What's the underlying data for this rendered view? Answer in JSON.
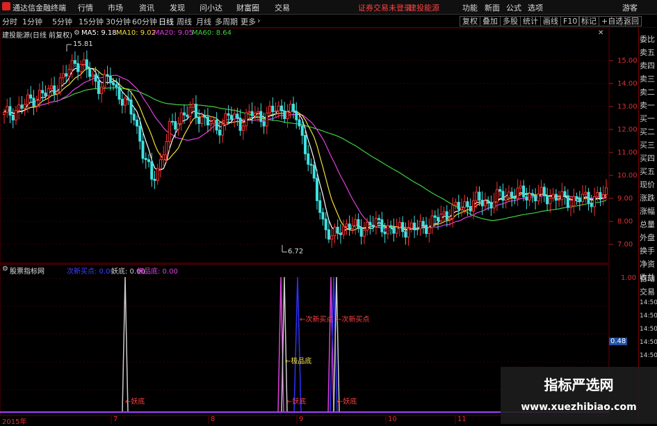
{
  "menubar": {
    "app_title": "通达信金融终端",
    "items": [
      "行情",
      "市场",
      "资讯",
      "发现",
      "问小达",
      "财富圈",
      "交易"
    ],
    "notice": "证券交易未登录",
    "stock": "建投能源",
    "right_items": [
      "功能",
      "新面",
      "公式",
      "选项"
    ],
    "guest": "游客"
  },
  "periodbar": {
    "periods": [
      "分时",
      "1分钟",
      "5分钟",
      "15分钟",
      "30分钟",
      "60分钟",
      "日线",
      "周线",
      "月线",
      "多周期",
      "更多"
    ],
    "selected": "日线",
    "buttons": [
      "复权",
      "叠加",
      "多股",
      "统计",
      "画线",
      "F10",
      "标记",
      "+自选",
      "返回"
    ]
  },
  "main_legend": {
    "title": "建投能源(日线 前复权)",
    "ma5": "MA5: 9.18",
    "ma10": "MA10: 9.02",
    "ma20": "MA20: 9.05",
    "ma60": "MA60: 8.64"
  },
  "price_axis": [
    "15.00",
    "14.00",
    "13.00",
    "12.00",
    "11.00",
    "10.00",
    "9.00",
    "8.00",
    "7.00"
  ],
  "annotations": {
    "high": "15.81",
    "low": "6.72"
  },
  "indicator_legend": {
    "title": "股票指标网",
    "item1": "次新买点: 0.00",
    "item2": "妖底: 0.00",
    "item3": "极品底: 0.00"
  },
  "indicator_axis": [
    "1.00",
    "0.48"
  ],
  "indicator_labels": {
    "yaodi": "妖底",
    "jipindi": "极品底",
    "cixin": "次新买点"
  },
  "time_axis": [
    "2015年",
    "7",
    "8",
    "9",
    "10",
    "11"
  ],
  "side_panel": [
    "委比",
    "卖五",
    "卖四",
    "卖三",
    "卖二",
    "卖一",
    "买一",
    "买二",
    "买三",
    "买四",
    "买五",
    "现价",
    "涨跌",
    "涨幅",
    "总量",
    "外盘",
    "换手",
    "净资",
    "收益",
    "自动",
    "交易",
    "14:50",
    "14:50",
    "14:50",
    "14:50",
    "14:50"
  ],
  "watermark": {
    "title": "指标严选网",
    "url": "www.xuezhibiao.com"
  },
  "colors": {
    "ma5": "#ffffff",
    "ma10": "#f0e040",
    "ma20": "#e040e0",
    "ma60": "#40d040",
    "up": "#ff3030",
    "down": "#40e0e0",
    "grid": "#6a0000"
  }
}
